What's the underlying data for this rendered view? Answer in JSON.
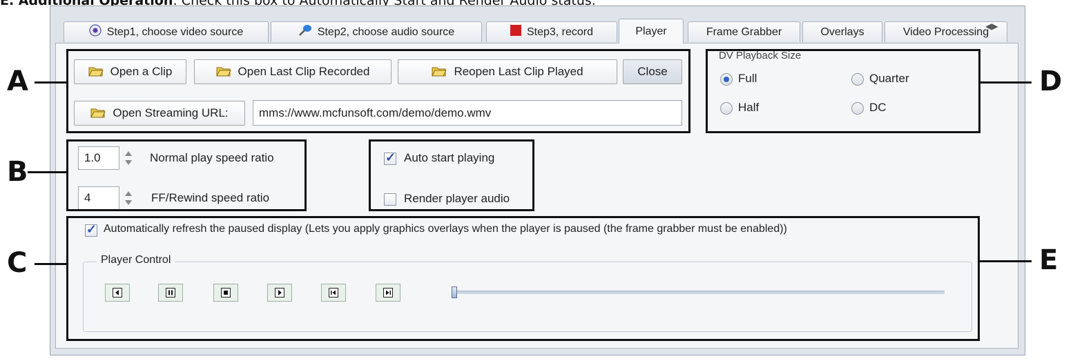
{
  "caption": {
    "bold": "E. Additional Operation",
    "rest": ": Check this box to Automatically Start and Render Audio status."
  },
  "tabs": [
    {
      "label": "Step1, choose video source",
      "icon": "webcam-icon"
    },
    {
      "label": "Step2, choose audio source",
      "icon": "microphone-icon"
    },
    {
      "label": "Step3, record",
      "icon": "record-icon"
    },
    {
      "label": "Player",
      "active": true
    },
    {
      "label": "Frame Grabber"
    },
    {
      "label": "Overlays"
    },
    {
      "label": "Video Processing"
    }
  ],
  "clip_buttons": {
    "open_clip": "Open a Clip",
    "open_last_recorded": "Open Last Clip Recorded",
    "reopen_last_played": "Reopen Last Clip Played",
    "close": "Close",
    "open_streaming": "Open Streaming URL:"
  },
  "streaming_url": "mms://www.mcfunsoft.com/demo/demo.wmv",
  "playback_size": {
    "title": "DV Playback Size",
    "options": [
      "Full",
      "Quarter",
      "Half",
      "DC"
    ],
    "selected": "Full"
  },
  "speed": {
    "normal_value": "1.0",
    "normal_label": "Normal play speed ratio",
    "ff_value": "4",
    "ff_label": "FF/Rewind speed ratio"
  },
  "playing": {
    "auto_start_label": "Auto start playing",
    "auto_start_checked": true,
    "render_audio_label": "Render player audio",
    "render_audio_checked": false
  },
  "auto_refresh": {
    "label": "Automatically refresh the paused display (Lets you apply graphics overlays when the player is paused (the frame grabber must be enabled))",
    "checked": true
  },
  "player_control": {
    "title": "Player Control",
    "buttons": [
      "rewind-icon",
      "pause-icon",
      "stop-icon",
      "play-icon",
      "step-back-icon",
      "step-forward-icon"
    ],
    "position_fraction": 0.0
  },
  "callouts": [
    "A",
    "B",
    "C",
    "D",
    "E"
  ],
  "colors": {
    "selection": "#2d62c8",
    "record_red": "#d01e1e",
    "callout": "#111111"
  }
}
